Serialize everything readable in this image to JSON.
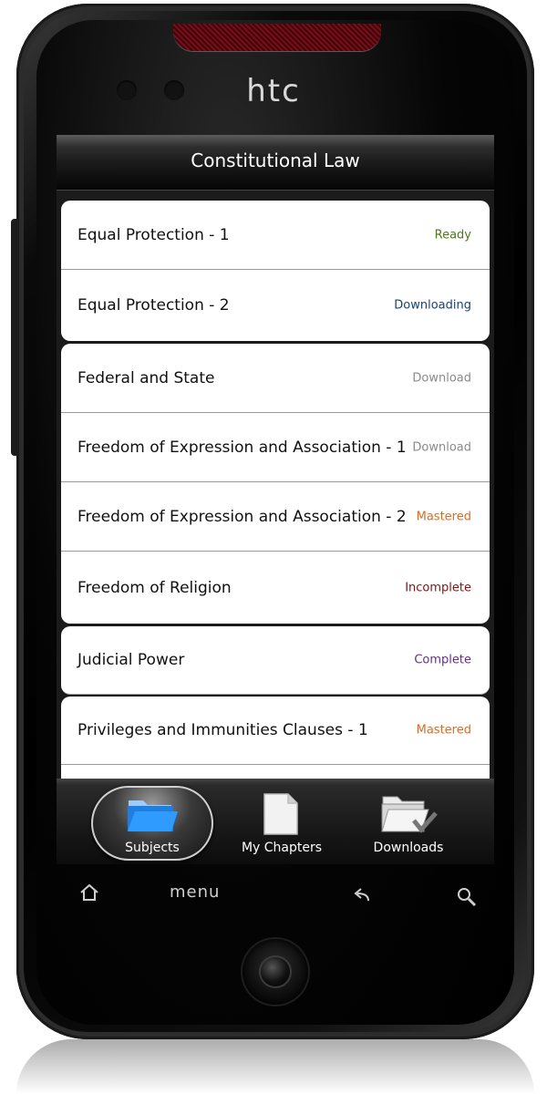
{
  "device": {
    "brand": "htc",
    "nav_menu_label": "menu"
  },
  "screen": {
    "title": "Constitutional Law",
    "chapters": [
      {
        "label": "Equal Protection - 1",
        "status": "Ready",
        "status_color": "#4a7a1a"
      },
      {
        "label": "Equal Protection - 2",
        "status": "Downloading",
        "status_color": "#1a3f7a"
      },
      {
        "label": "Federal and State",
        "status": "Download",
        "status_color": "#8a8a8a"
      },
      {
        "label": "Freedom of Expression and Association - 1",
        "status": "Download",
        "status_color": "#8a8a8a"
      },
      {
        "label": "Freedom of Expression and Association - 2",
        "status": "Mastered",
        "status_color": "#e06a22"
      },
      {
        "label": "Freedom of Religion",
        "status": "Incomplete",
        "status_color": "#8a1010"
      },
      {
        "label": "Judicial Power",
        "status": "Complete",
        "status_color": "#6a2a9a"
      },
      {
        "label": "Privileges and Immunities Clauses - 1",
        "status": "Mastered",
        "status_color": "#e06a22"
      }
    ],
    "tabs": [
      {
        "label": "Subjects",
        "icon": "folder-open-icon",
        "selected": true
      },
      {
        "label": "My Chapters",
        "icon": "document-icon",
        "selected": false
      },
      {
        "label": "Downloads",
        "icon": "folder-download-icon",
        "selected": false
      }
    ]
  }
}
